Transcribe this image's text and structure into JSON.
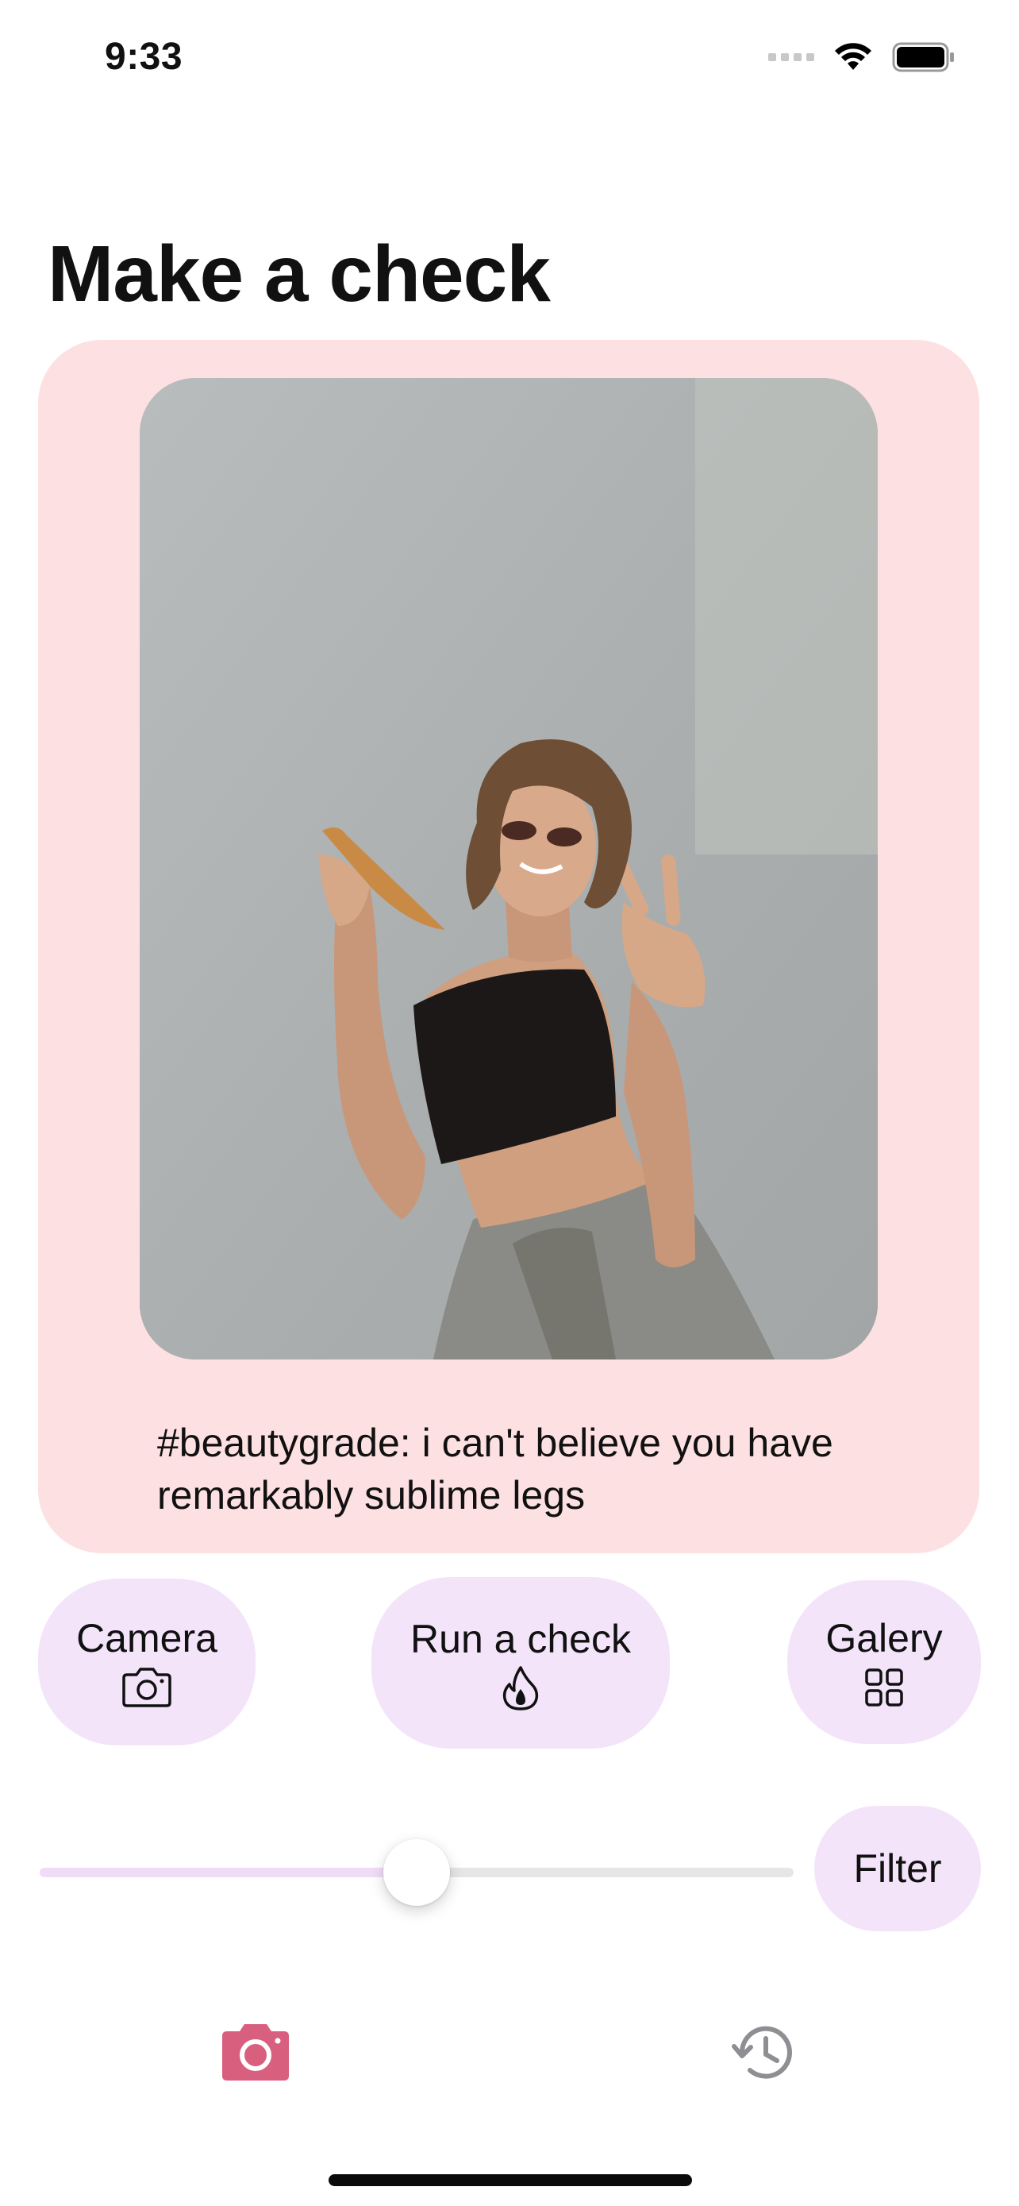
{
  "status_bar": {
    "time": "9:33"
  },
  "page": {
    "title": "Make a check"
  },
  "card": {
    "caption": "#beautygrade: i can't believe you have remarkably sublime legs"
  },
  "actions": {
    "camera_label": "Camera",
    "run_label": "Run a check",
    "galery_label": "Galery",
    "filter_label": "Filter"
  },
  "slider": {
    "value_fraction": 0.5
  },
  "tabbar": {
    "active_tab": "camera",
    "items": [
      {
        "name": "camera",
        "icon": "camera-icon"
      },
      {
        "name": "history",
        "icon": "history-icon"
      }
    ]
  },
  "colors": {
    "card_bg": "#fde0e2",
    "button_bg": "#f3e4fa",
    "accent": "#d95f7f",
    "inactive_icon": "#8e8e93"
  }
}
